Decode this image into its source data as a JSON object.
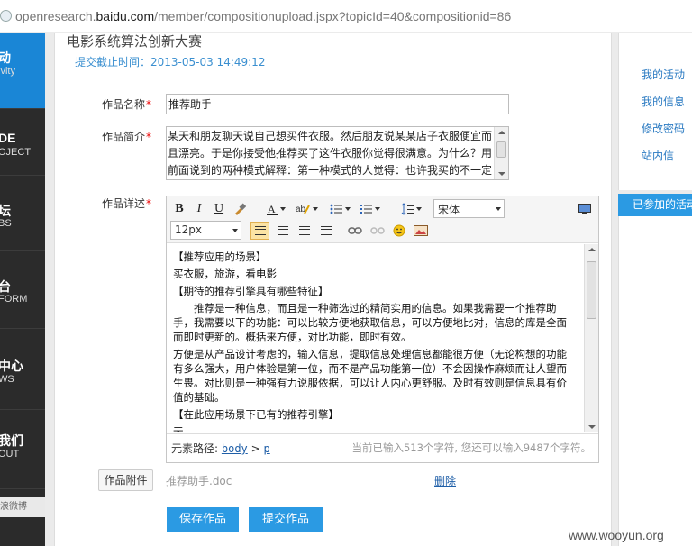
{
  "browser": {
    "url_prefix": "openresearch.",
    "url_domain": "baidu.com",
    "url_path": "/member/compositionupload.jspx?topicId=40&compositionid=86"
  },
  "leftnav": [
    {
      "cn": "动",
      "en": "ivity",
      "active": true
    },
    {
      "cn": "DE",
      "en": "OJECT",
      "active": false
    },
    {
      "cn": "坛",
      "en": "BS",
      "active": false
    },
    {
      "cn": "台",
      "en": "FORM",
      "active": false
    },
    {
      "cn": "中心",
      "en": "WS",
      "active": false
    },
    {
      "cn": "我们",
      "en": "OUT",
      "active": false
    }
  ],
  "leftnav_weibo": "浪微博",
  "page": {
    "title": "电影系统算法创新大赛",
    "deadline": "提交截止时间：2013-05-03 14:49:12"
  },
  "form": {
    "name_label": "作品名称",
    "name_value": "推荐助手",
    "intro_label": "作品简介",
    "intro_text": "某天和朋友聊天说自己想买件衣服。然后朋友说某某店子衣服便宜而且漂亮。于是你接受他推荐买了这件衣服你觉得很满意。为什么？用前面说到的两种模式解释：第一种模式的人觉得：也许我买的不一定",
    "detail_label": "作品详述",
    "required_mark": "*",
    "attach_label": "作品附件",
    "attach_file": "推荐助手.doc",
    "delete_label": "删除",
    "save_label": "保存作品",
    "submit_label": "提交作品"
  },
  "editor": {
    "bold": "B",
    "italic": "I",
    "underline": "U",
    "font_family": "宋体",
    "font_size": "12px",
    "content": [
      "【推荐应用的场景】",
      "买衣服，旅游，看电影",
      "【期待的推荐引擎具有哪些特征】",
      "　　推荐是一种信息，而且是一种筛选过的精简实用的信息。如果我需要一个推荐助手，我需要以下的功能：可以比较方便地获取信息，可以方便地比对，信息的库是全面而即时更新的。概括来方便，对比功能，即时有效。",
      "方便是从产品设计考虑的，输入信息，提取信息处理信息都能很方便（无论构想的功能有多么强大，用户体验是第一位，而不是产品功能第一位）不会因操作麻烦而让人望而生畏。对比则是一种强有力说服依据，可以让人内心更舒服。及时有效则是信息具有价值的基础。",
      "【在此应用场景下已有的推荐引擎】",
      "无"
    ],
    "path_label": "元素路径:",
    "path_body": "body",
    "path_sep": ">",
    "path_p": "p",
    "char_count": "当前已输入513个字符, 您还可以输入9487个字符。"
  },
  "right": {
    "links": [
      "我的活动",
      "我的信息",
      "修改密码",
      "站内信"
    ],
    "tab": "已参加的活动"
  },
  "watermark": "www.wooyun.org",
  "colors": {
    "accent": "#2b9ae3",
    "nav_bg": "#2b2b2b",
    "link": "#2a7ac2",
    "required": "#e00000"
  }
}
